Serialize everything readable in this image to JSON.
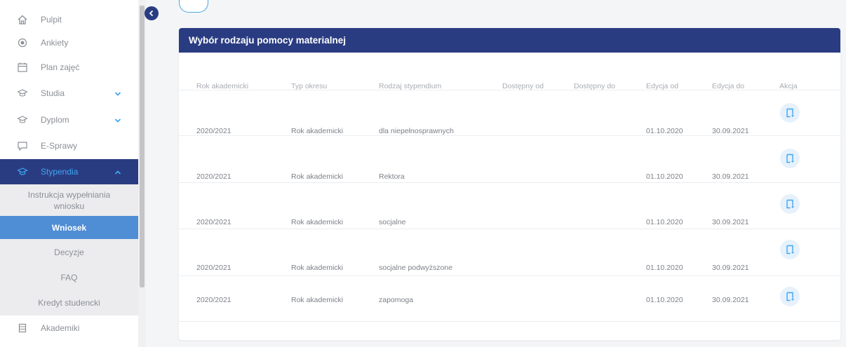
{
  "sidebar": {
    "items": [
      {
        "label": "Pulpit",
        "icon": "home-icon"
      },
      {
        "label": "Ankiety",
        "icon": "radio-icon"
      },
      {
        "label": "Plan zajęć",
        "icon": "calendar-icon"
      },
      {
        "label": "Studia",
        "icon": "graduation-cap-icon",
        "expandable": true
      },
      {
        "label": "Dyplom",
        "icon": "graduation-cap-icon",
        "expandable": true
      },
      {
        "label": "E-Sprawy",
        "icon": "chat-icon"
      },
      {
        "label": "Stypendia",
        "icon": "graduation-cap-icon",
        "expandable": true,
        "active": true
      },
      {
        "label": "Akademiki",
        "icon": "building-icon"
      }
    ],
    "subitems": [
      {
        "label": "Instrukcja wypełniania wniosku"
      },
      {
        "label": "Wniosek",
        "selected": true
      },
      {
        "label": "Decyzje"
      },
      {
        "label": "FAQ"
      },
      {
        "label": "Kredyt studencki"
      }
    ]
  },
  "card": {
    "title": "Wybór rodzaju pomocy materialnej",
    "columns": [
      "Rok akademicki",
      "Typ okresu",
      "Rodzaj stypendium",
      "Dostępny od",
      "Dostępny do",
      "Edycja od",
      "Edycja do",
      "Akcja"
    ],
    "rows": [
      {
        "rok": "2020/2021",
        "typ": "Rok akademicki",
        "rodzaj": "dla niepełnosprawnych",
        "dostepny_od": "",
        "dostepny_do": "",
        "edycja_od": "01.10.2020",
        "edycja_do": "30.09.2021"
      },
      {
        "rok": "2020/2021",
        "typ": "Rok akademicki",
        "rodzaj": "Rektora",
        "dostepny_od": "",
        "dostepny_do": "",
        "edycja_od": "01.10.2020",
        "edycja_do": "30.09.2021"
      },
      {
        "rok": "2020/2021",
        "typ": "Rok akademicki",
        "rodzaj": "socjalne",
        "dostepny_od": "",
        "dostepny_do": "",
        "edycja_od": "01.10.2020",
        "edycja_do": "30.09.2021"
      },
      {
        "rok": "2020/2021",
        "typ": "Rok akademicki",
        "rodzaj": "socjalne podwyższone",
        "dostepny_od": "",
        "dostepny_do": "",
        "edycja_od": "01.10.2020",
        "edycja_do": "30.09.2021"
      },
      {
        "rok": "2020/2021",
        "typ": "Rok akademicki",
        "rodzaj": "zapomoga",
        "dostepny_od": "",
        "dostepny_do": "",
        "edycja_od": "01.10.2020",
        "edycja_do": "30.09.2021"
      }
    ]
  },
  "colors": {
    "primary": "#2a3c81",
    "accent": "#3ea6f3",
    "selected": "#4f8dd4"
  }
}
